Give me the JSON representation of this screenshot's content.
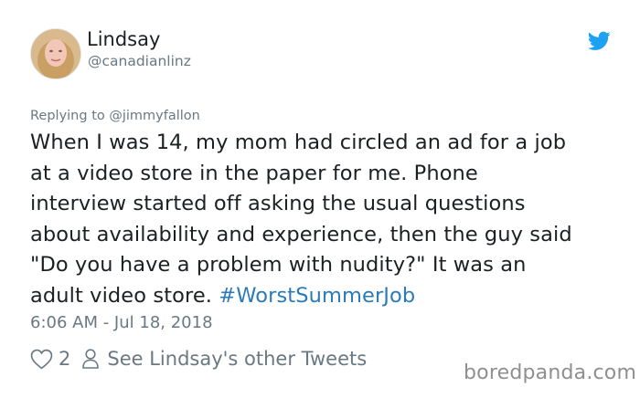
{
  "user": {
    "display_name": "Lindsay",
    "handle": "@canadianlinz"
  },
  "icons": {
    "brand": "twitter-bird-icon",
    "like": "heart-icon",
    "profile": "person-icon"
  },
  "reply": {
    "text": "Replying to @jimmyfallon"
  },
  "tweet": {
    "lines": [
      "When I was 14, my mom had circled an ad for a job",
      "at a video store in the paper for me. Phone",
      "interview started off asking the usual questions",
      "about availability and experience, then the guy said",
      "\"Do you have a problem with nudity?\" It was an",
      "adult video store. "
    ],
    "hashtag": "#WorstSummerJob",
    "timestamp": "6:06 AM - Jul 18, 2018"
  },
  "actions": {
    "like_count": "2",
    "profile_link": "See Lindsay's other Tweets"
  },
  "watermark": "boredpanda.com",
  "colors": {
    "text": "#1c2022",
    "muted": "#697882",
    "link": "#2b7bb9",
    "twitter_blue": "#1da1f2"
  }
}
